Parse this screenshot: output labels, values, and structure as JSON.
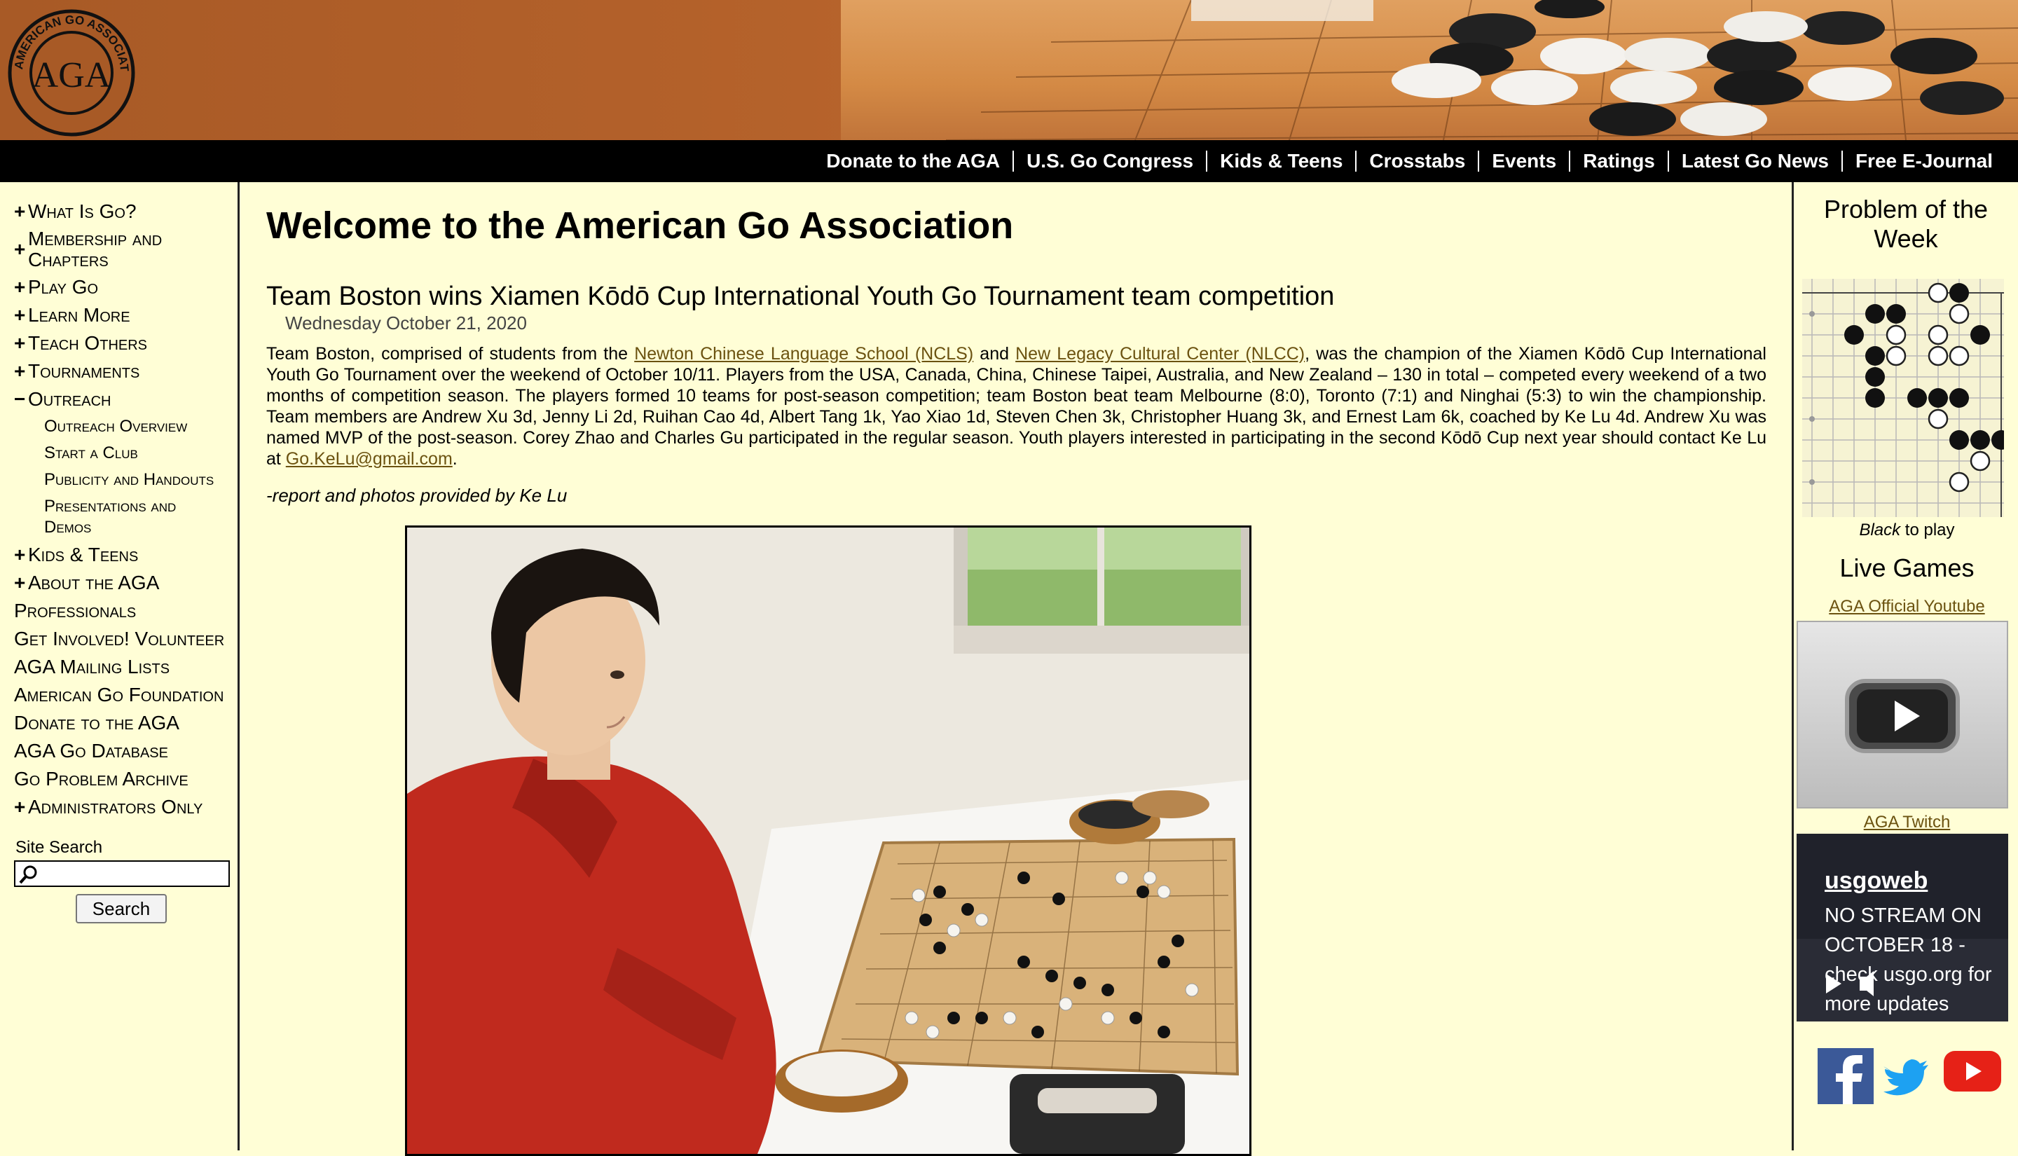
{
  "logo": {
    "text": "AMERICAN GO ASSOCIATION",
    "mark": "AGA"
  },
  "nav": [
    "Donate to the AGA",
    "U.S. Go Congress",
    "Kids & Teens",
    "Crosstabs",
    "Events",
    "Ratings",
    "Latest Go News",
    "Free E-Journal"
  ],
  "sidebar": {
    "items": [
      {
        "pm": "+",
        "label": "What Is Go?"
      },
      {
        "pm": "+",
        "label": "Membership and Chapters"
      },
      {
        "pm": "+",
        "label": "Play Go"
      },
      {
        "pm": "+",
        "label": "Learn More"
      },
      {
        "pm": "+",
        "label": "Teach Others"
      },
      {
        "pm": "+",
        "label": "Tournaments"
      },
      {
        "pm": "−",
        "label": "Outreach"
      }
    ],
    "outreach_sub": [
      "Outreach Overview",
      "Start a Club",
      "Publicity and Handouts",
      "Presentations and Demos"
    ],
    "items2": [
      {
        "pm": "+",
        "label": "Kids & Teens"
      },
      {
        "pm": "+",
        "label": "About the AGA"
      },
      {
        "pm": "",
        "label": "Professionals"
      },
      {
        "pm": "",
        "label": "Get Involved! Volunteer"
      },
      {
        "pm": "",
        "label": "AGA Mailing Lists"
      },
      {
        "pm": "",
        "label": "American Go Foundation"
      },
      {
        "pm": "",
        "label": "Donate to the AGA"
      },
      {
        "pm": "",
        "label": "AGA Go Database"
      },
      {
        "pm": "",
        "label": "Go Problem Archive"
      },
      {
        "pm": "+",
        "label": "Administrators Only"
      }
    ],
    "search_label": "Site Search",
    "search_value": "",
    "search_button": "Search"
  },
  "main": {
    "page_title": "Welcome to the American Go Association",
    "article_title": "Team Boston wins Xiamen Kōdō Cup International Youth Go Tournament team competition",
    "article_date": "Wednesday October 21, 2020",
    "body_parts": [
      "Team Boston, comprised of students from the ",
      "Newton Chinese Language School (NCLS)",
      " and ",
      "New Legacy Cultural Center (NLCC)",
      ", was the champion of the Xiamen Kōdō Cup International Youth Go Tournament over the weekend of October 10/11. Players from the USA, Canada, China, Chinese Taipei, Australia, and New Zealand – 130 in total – competed every weekend of a two months of competition season. The players formed 10 teams for post-season competition; team Boston beat team Melbourne (8:0), Toronto (7:1) and Ninghai (5:3) to win the championship. Team members are Andrew Xu 3d, Jenny Li 2d, Ruihan Cao 4d, Albert Tang 1k, Yao Xiao 1d, Steven Chen 3k, Christopher Huang 3k, and Ernest Lam 6k, coached by Ke Lu 4d. Andrew Xu was named MVP of the post-season. Corey Zhao and Charles Gu participated in the regular season. Youth players interested in participating in the second Kōdō Cup next year should contact Ke Lu at ",
      "Go.KeLu@gmail.com",
      "."
    ],
    "credit": "-report and photos provided by Ke Lu"
  },
  "right": {
    "potw_title": "Problem of the Week",
    "potw_caption_em": "Black",
    "potw_caption_rest": " to play",
    "live_title": "Live Games",
    "yt_link": "AGA Official Youtube",
    "twitch_link": "AGA Twitch",
    "twitch_channel": "usgoweb",
    "twitch_status": "NO STREAM ON OCTOBER 18 - check usgo.org for more updates"
  },
  "colors": {
    "background": "#fffed6",
    "header_orange": "#b5622b",
    "navbar": "#000000",
    "link": "#6b5210",
    "facebook": "#3b5998",
    "twitter": "#1da1f2",
    "youtube": "#e62117"
  }
}
